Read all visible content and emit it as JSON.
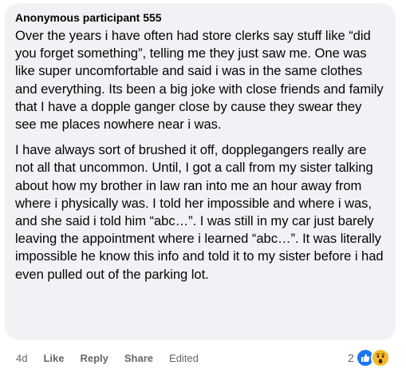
{
  "comment": {
    "author": "Anonymous participant 555",
    "paragraphs": [
      "Over the years i have often had store clerks say stuff like “did you forget something”, telling me they just saw me. One was like super uncomfortable and said i was in the same clothes and everything. Its been a big joke with close friends and family that I have a dopple ganger close by cause they swear they see me places nowhere near i was.",
      "I have always sort of brushed it off, dopplegangers really are not all that uncommon. Until, I got a call from my sister talking about how my brother in law ran into me an hour away from where i physically was. I told her impossible and where i was, and she said i told him “abc…”. I was still in my car just barely leaving the appointment where i learned “abc…”. It was literally impossible he know this info and told it to my sister before i had even pulled out of the parking lot."
    ]
  },
  "actions": {
    "time": "4d",
    "like": "Like",
    "reply": "Reply",
    "share": "Share",
    "edited": "Edited"
  },
  "reactions": {
    "count": "2",
    "icons": [
      "like-icon",
      "wow-icon"
    ],
    "colors": {
      "like": "#1877f2",
      "wow": "#f7b928"
    }
  },
  "colors": {
    "bubble_background": "#f0f2f5",
    "text": "#050505",
    "secondary_text": "#65676b"
  }
}
